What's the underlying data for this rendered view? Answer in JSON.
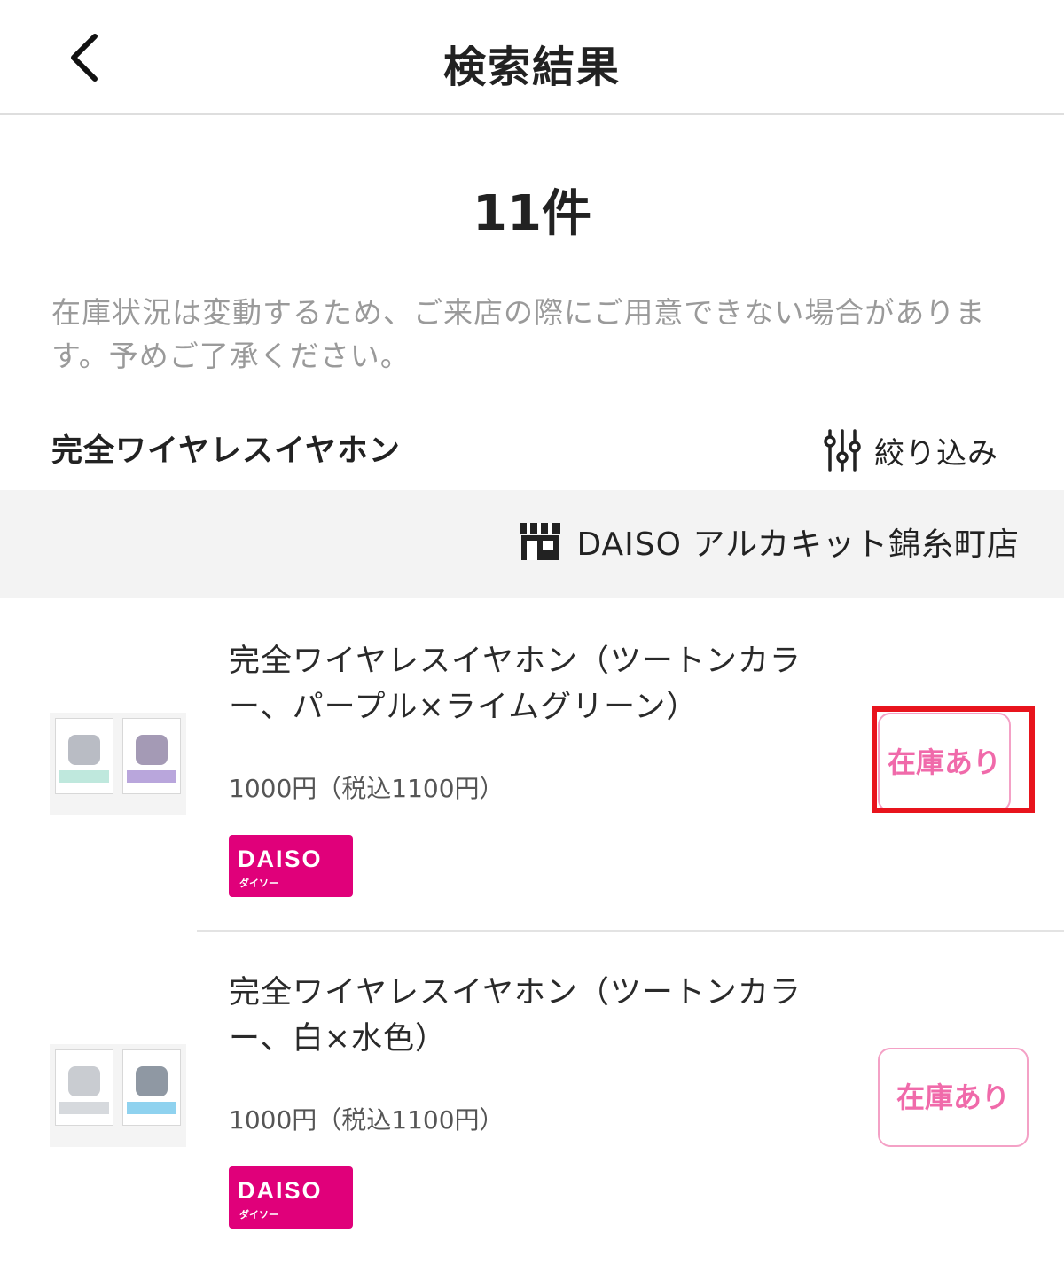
{
  "header": {
    "title": "検索結果"
  },
  "results": {
    "count": "11件",
    "notice": "在庫状況は変動するため、ご来店の際にご用意できない場合があります。予めご了承ください。"
  },
  "search": {
    "keyword": "完全ワイヤレスイヤホン",
    "filter_label": "絞り込み"
  },
  "store": {
    "name": "DAISO アルカキット錦糸町店"
  },
  "products": [
    {
      "name": "完全ワイヤレスイヤホン（ツートンカラー、パープル×ライムグリーン）",
      "price": "1000円（税込1100円）",
      "brand": "DAISO",
      "brand_sub": "ダイソー",
      "stock": "在庫あり"
    },
    {
      "name": "完全ワイヤレスイヤホン（ツートンカラー、白×水色）",
      "price": "1000円（税込1100円）",
      "brand": "DAISO",
      "brand_sub": "ダイソー",
      "stock": "在庫あり"
    }
  ],
  "colors": {
    "brand": "#e0007a",
    "stock_text": "#f06aaa",
    "highlight": "#e8141d"
  },
  "icons": {
    "back": "chevron-left-icon",
    "filter": "sliders-icon",
    "store": "storefront-icon"
  }
}
